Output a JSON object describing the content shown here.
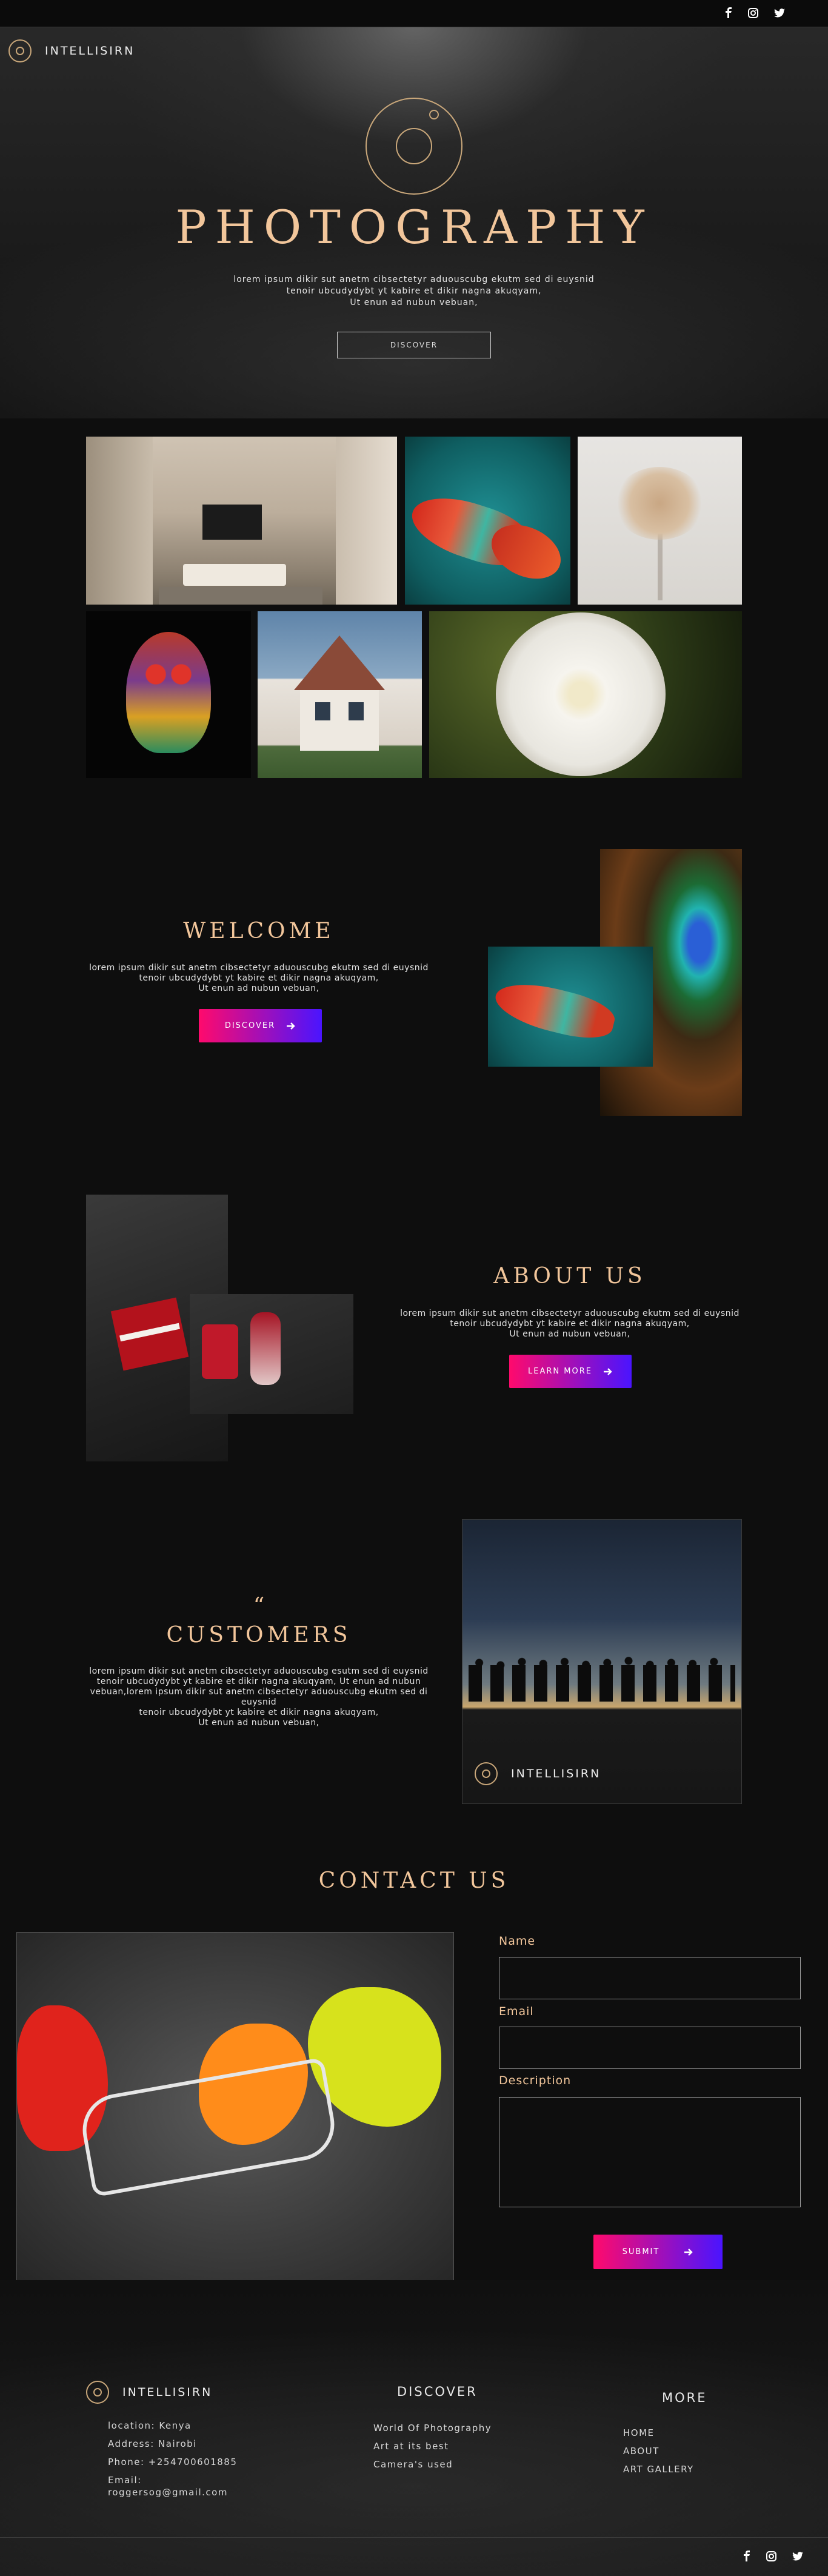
{
  "brand": {
    "name": "INTELLISIRN"
  },
  "social": [
    {
      "name": "facebook-icon"
    },
    {
      "name": "instagram-icon"
    },
    {
      "name": "twitter-icon"
    }
  ],
  "hero": {
    "title": "PHOTOGRAPHY",
    "line1": "lorem ipsum dikir sut anetm cibsectetyr aduouscubg ekutm sed di euysnid",
    "line2": "tenoir ubcudydybt yt kabire et dikir nagna akuqyam,",
    "line3": "Ut enun ad nubun vebuan,",
    "button": "DISCOVER"
  },
  "welcome": {
    "title": "WELCOME",
    "line1": "lorem ipsum dikir sut anetm cibsectetyr aduouscubg ekutm sed di euysnid",
    "line2": "tenoir ubcudydybt yt kabire et dikir nagna akuqyam,",
    "line3": "Ut enun ad nubun vebuan,",
    "button": "DISCOVER"
  },
  "about": {
    "title": "ABOUT US",
    "line1": "lorem ipsum dikir sut anetm cibsectetyr aduouscubg ekutm sed di euysnid",
    "line2": "tenoir ubcudydybt yt kabire et dikir nagna akuqyam,",
    "line3": "Ut enun ad nubun vebuan,",
    "button": "LEARN MORE"
  },
  "customers": {
    "quote": "“",
    "title": "CUSTOMERS",
    "line1": "lorem ipsum dikir sut anetm cibsectetyr aduouscubg esutm sed di euysnid",
    "line2": "tenoir ubcudydybt yt kabire et dikir nagna akuqyam,  Ut enun ad nubun",
    "line3": "vebuan,lorem ipsum dikir sut anetm cibsectetyr aduouscubg ekutm sed di euysnid",
    "line4": "tenoir ubcudydybt yt kabire et dikir nagna akuqyam,",
    "line5": "Ut enun ad nubun vebuan,"
  },
  "contact": {
    "title": "CONTACT US",
    "name_label": "Name",
    "email_label": "Email",
    "description_label": "Description",
    "submit": "SUBMIT"
  },
  "footer": {
    "brand": "INTELLISIRN",
    "location": "location: Kenya",
    "address": "Address: Nairobi",
    "phone": "Phone: +254700601885",
    "email_label": "Email:",
    "email": "roggersog@gmail.com",
    "discover_head": "DISCOVER",
    "discover_items": [
      "World Of Photography",
      "Art at its best",
      "Camera's used"
    ],
    "more_head": "MORE",
    "more_items": [
      "HOME",
      "ABOUT",
      "ART GALLERY"
    ]
  },
  "colors": {
    "accent": "#f2c69b",
    "gradient_start": "#ff0a6c",
    "gradient_end": "#4a14ff"
  }
}
